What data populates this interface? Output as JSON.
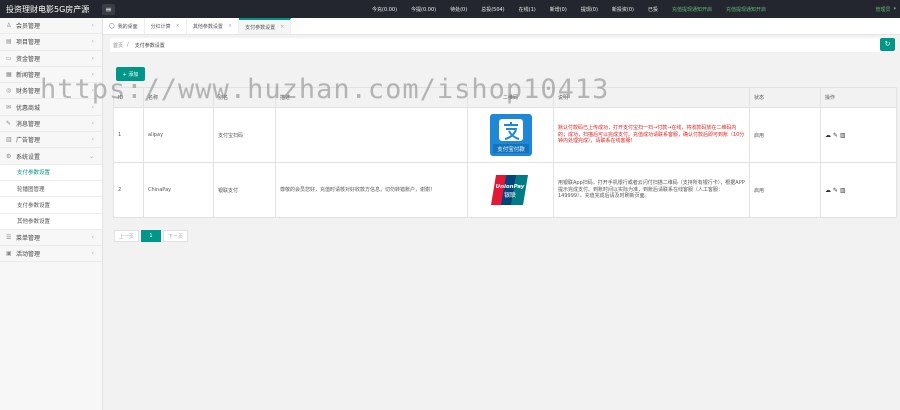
{
  "app": {
    "brand": "投资理财电影5G房产源",
    "menu_icon": "menu-icon"
  },
  "top_stats": [
    {
      "label": "今充(0.00)",
      "color": "#eeeeee"
    },
    {
      "label": "今提(0.00)",
      "color": "#eeeeee"
    },
    {
      "label": "待处(0)",
      "color": "#eeeeee"
    },
    {
      "label": "总投(504)",
      "color": "#eeeeee"
    },
    {
      "label": "在线(1)",
      "color": "#eeeeee"
    },
    {
      "label": "新增(0)",
      "color": "#eeeeee"
    },
    {
      "label": "提现(0)",
      "color": "#eeeeee"
    },
    {
      "label": "新投资(0)",
      "color": "#eeeeee"
    },
    {
      "label": "已投",
      "color": "#eeeeee"
    },
    {
      "label": "充值提现通知开启",
      "color": "#5fb878"
    },
    {
      "label": "充值提现通知开启",
      "color": "#5fb878"
    }
  ],
  "user": {
    "label": "管理员"
  },
  "sidebar": [
    {
      "label": "会员管理",
      "icon": "user-icon",
      "sub": false
    },
    {
      "label": "项目管理",
      "icon": "folder-icon",
      "sub": false
    },
    {
      "label": "资金管理",
      "icon": "wallet-icon",
      "sub": false
    },
    {
      "label": "新闻管理",
      "icon": "news-icon",
      "sub": false
    },
    {
      "label": "财务管理",
      "icon": "finance-icon",
      "sub": false
    },
    {
      "label": "优惠商城",
      "icon": "gift-icon",
      "sub": false
    },
    {
      "label": "消息管理",
      "icon": "message-icon",
      "sub": false
    },
    {
      "label": "广告管理",
      "icon": "ad-icon",
      "sub": false
    },
    {
      "label": "系统设置",
      "icon": "gear-icon",
      "sub": false,
      "open": true
    },
    {
      "label": "支付参数设置",
      "sub": true,
      "active": true
    },
    {
      "label": "轮播图管理",
      "sub": true
    },
    {
      "label": "支付参数设置",
      "sub": true
    },
    {
      "label": "其他参数设置",
      "sub": true
    },
    {
      "label": "菜单管理",
      "icon": "list-icon",
      "sub": false
    },
    {
      "label": "活动管理",
      "icon": "activity-icon",
      "sub": false
    }
  ],
  "tabs": [
    {
      "label": "我的桌面",
      "closable": false
    },
    {
      "label": "分红计算",
      "closable": true
    },
    {
      "label": "其他参数设置",
      "closable": true
    },
    {
      "label": "支付参数设置",
      "closable": true,
      "active": true
    }
  ],
  "breadcrumb": {
    "home": "首页",
    "sep": "/",
    "current": "支付参数设置"
  },
  "toolbar": {
    "add_label": "+ 添加",
    "refresh_icon": "refresh-icon"
  },
  "table": {
    "headers": [
      "ID",
      "名称",
      "别名",
      "描述",
      "二维码",
      "说明",
      "状态",
      "操作"
    ],
    "rows": [
      {
        "id": "1",
        "code": "alipay",
        "name": "支付宝扫码",
        "desc": "",
        "logo": "alipay-logo",
        "note": "默认付款码已上传成功，打开支付宝扫一扫→付款→在线，将收款码放在二维码内的；成功，扫描后可以完成支付。充值成功请联系客服，确认付款后即可到账（10分钟内处理完成），请联系在线客服！",
        "status": "启用"
      },
      {
        "id": "2",
        "code": "ChinaPay",
        "name": "银联支付",
        "desc": "尊敬的会员您好，充值时请核对好收款方信息，切勿转错账户，谢谢！",
        "logo": "unionpay-logo",
        "note": "用银联App扫码，打开手机银行或者云闪付扫描二维码（支持所有银行卡），根据APP提示完成支付。到账时间以实际为准，到账后请联系在线客服（人工客服：149999），充值完成后请及时刷新页面。",
        "status": "启用"
      }
    ]
  },
  "pager": {
    "prev": "上一页",
    "current": "1",
    "next": "下一页"
  },
  "watermark": "https://www.huzhan.com/ishop10413",
  "colors": {
    "accent": "#009688",
    "topbar": "#23262e",
    "alert": "#e02020"
  }
}
